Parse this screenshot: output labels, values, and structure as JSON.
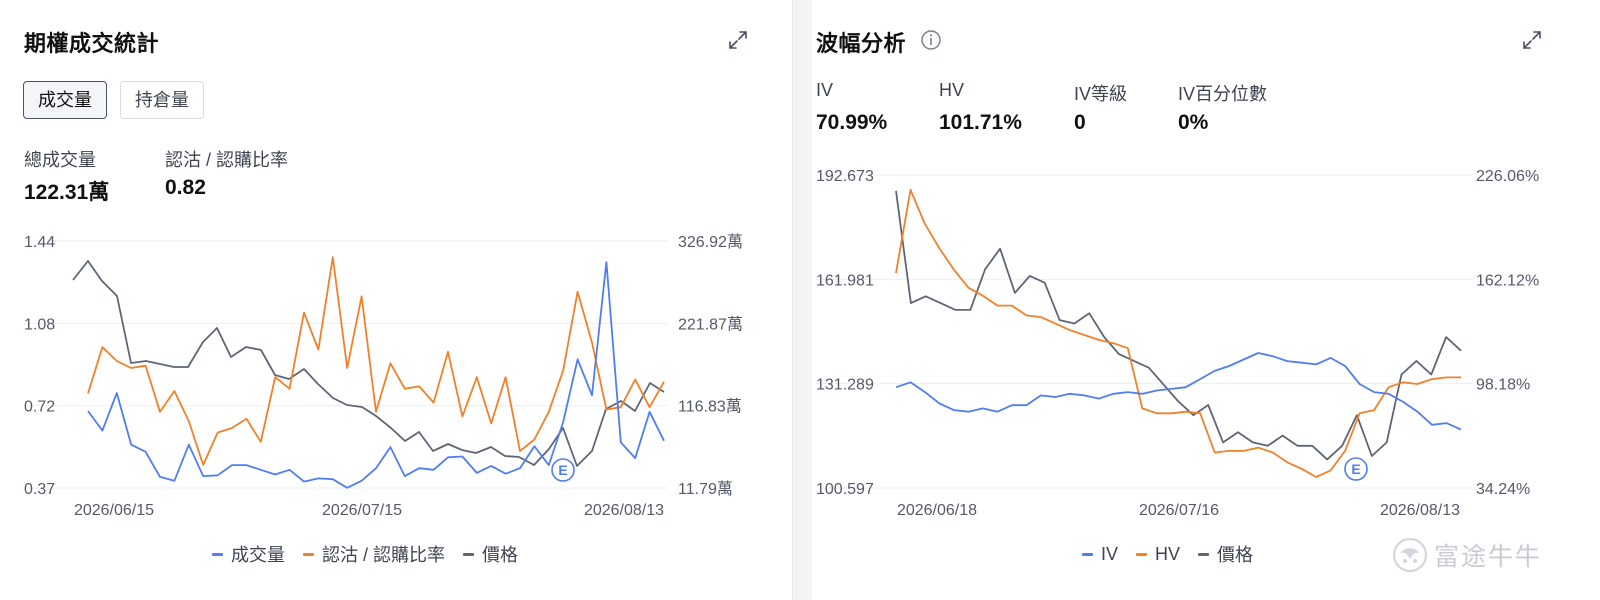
{
  "left_panel": {
    "title": "期權成交統計",
    "tabs": [
      {
        "label": "成交量",
        "active": true
      },
      {
        "label": "持倉量",
        "active": false
      }
    ],
    "stats": [
      {
        "label": "總成交量",
        "value": "122.31萬"
      },
      {
        "label": "認沽 / 認購比率",
        "value": "0.82"
      }
    ]
  },
  "right_panel": {
    "title": "波幅分析",
    "stats": [
      {
        "label": "IV",
        "value": "70.99%"
      },
      {
        "label": "HV",
        "value": "101.71%"
      },
      {
        "label": "IV等級",
        "value": "0"
      },
      {
        "label": "IV百分位數",
        "value": "0%"
      }
    ]
  },
  "colors": {
    "blue": "#4f7ef0",
    "orange": "#f0812a",
    "gray": "#5e6676",
    "grid": "#eceef2",
    "earnings_marker": "#4f7ef0"
  },
  "icons": [
    "expand-icon",
    "info-icon",
    "earnings-marker-icon",
    "futu-logo-icon"
  ],
  "watermark": {
    "text": "富途牛牛"
  },
  "chart_data": [
    {
      "type": "line",
      "title": "期權成交統計",
      "x_tick_labels": [
        "2026/06/15",
        "2026/07/15",
        "2026/08/13"
      ],
      "left_axis": {
        "ticks": [
          "1.44",
          "1.08",
          "0.72",
          "0.37"
        ],
        "range": [
          0.37,
          1.44
        ]
      },
      "right_axis": {
        "ticks": [
          "326.92萬",
          "221.87萬",
          "116.83萬",
          "11.79萬"
        ],
        "range": [
          11.79,
          326.92
        ],
        "unit": "萬"
      },
      "grid": true,
      "legend_position": "bottom",
      "markers": [
        {
          "label": "E",
          "x_index": 34
        }
      ],
      "series": [
        {
          "name": "成交量",
          "axis": "right",
          "color": "#4f7ef0",
          "values": [
            110,
            85,
            133,
            67,
            58,
            26,
            21,
            67,
            27,
            28,
            41,
            41,
            35,
            29,
            35,
            20,
            24,
            23,
            12,
            21,
            37,
            64,
            27,
            37,
            35,
            51,
            52,
            31,
            40,
            30,
            37,
            65,
            41,
            96,
            176,
            130,
            300,
            70,
            50,
            109,
            72
          ]
        },
        {
          "name": "認沽 / 認購比率",
          "axis": "left",
          "color": "#f0812a",
          "values": [
            0.78,
            0.98,
            0.92,
            0.89,
            0.9,
            0.7,
            0.79,
            0.66,
            0.47,
            0.61,
            0.63,
            0.67,
            0.57,
            0.85,
            0.8,
            1.13,
            0.97,
            1.37,
            0.89,
            1.2,
            0.7,
            0.91,
            0.8,
            0.81,
            0.74,
            0.96,
            0.68,
            0.85,
            0.65,
            0.85,
            0.53,
            0.58,
            0.7,
            0.88,
            1.22,
            1.0,
            0.71,
            0.72,
            0.84,
            0.72,
            0.83
          ]
        },
        {
          "name": "價格",
          "axis": "right",
          "color": "#5e6676",
          "values": []
        }
      ]
    },
    {
      "type": "line",
      "title": "波幅分析",
      "x_tick_labels": [
        "2026/06/18",
        "2026/07/16",
        "2026/08/13"
      ],
      "left_axis": {
        "ticks": [
          "192.673",
          "161.981",
          "131.289",
          "100.597"
        ],
        "range": [
          100.597,
          192.673
        ]
      },
      "right_axis": {
        "ticks": [
          "226.06%",
          "162.12%",
          "98.18%",
          "34.24%"
        ],
        "range": [
          34.24,
          226.06
        ],
        "unit": "%"
      },
      "grid": true,
      "legend_position": "bottom",
      "markers": [
        {
          "label": "E",
          "x_index": 31
        }
      ],
      "series": [
        {
          "name": "IV",
          "axis": "right",
          "color": "#4f7ef0",
          "values": [
            96,
            99,
            93,
            86,
            82,
            81,
            83,
            81,
            85,
            85,
            91,
            90,
            92,
            91,
            89,
            92,
            93,
            92,
            94,
            95,
            96,
            101,
            106,
            109,
            113,
            117,
            115,
            112,
            111,
            110,
            114,
            109,
            98,
            93,
            92,
            87,
            81,
            73,
            74,
            70
          ]
        },
        {
          "name": "HV",
          "axis": "right",
          "color": "#f0812a",
          "values": [
            166,
            217,
            196,
            181,
            168,
            157,
            152,
            146,
            146,
            140,
            139,
            135,
            131,
            128,
            125,
            123,
            120,
            83,
            80,
            80,
            81,
            80,
            56,
            57,
            57,
            59,
            56,
            50,
            46,
            41,
            45,
            57,
            80,
            82,
            96,
            99,
            98,
            101,
            102,
            102
          ]
        },
        {
          "name": "價格",
          "axis": "left",
          "color": "#5e6676",
          "values": [
            188,
            155,
            157,
            155,
            153,
            153,
            165,
            171,
            158,
            163,
            161,
            150,
            149,
            152,
            145,
            140,
            138,
            136,
            131,
            126,
            122,
            125,
            114,
            117,
            114,
            113,
            116,
            113,
            113,
            109,
            113,
            122,
            110,
            114,
            134,
            138,
            134,
            145,
            141
          ]
        }
      ]
    }
  ]
}
